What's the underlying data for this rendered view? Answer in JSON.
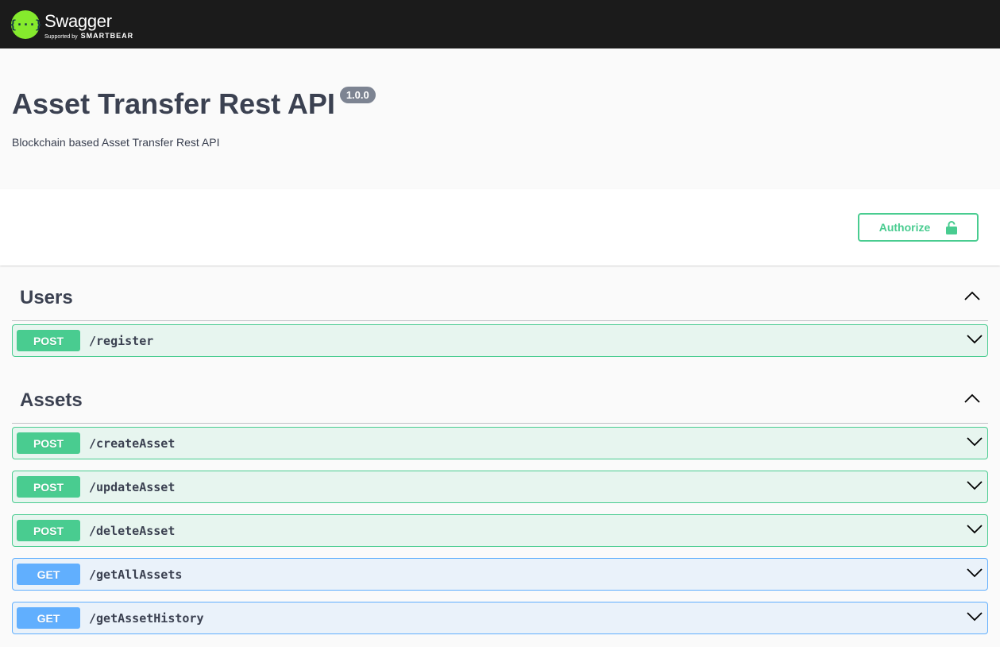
{
  "topbar": {
    "logo_glyph": "{···}",
    "logo_name": "Swagger",
    "logo_sub": "Supported by",
    "logo_brand": "SMARTBEAR"
  },
  "info": {
    "title": "Asset Transfer Rest API",
    "version": "1.0.0",
    "description": "Blockchain based Asset Transfer Rest API"
  },
  "auth": {
    "label": "Authorize",
    "icon": "lock-icon"
  },
  "tags": [
    {
      "name": "Users",
      "operations": [
        {
          "method": "POST",
          "path": "/register"
        }
      ]
    },
    {
      "name": "Assets",
      "operations": [
        {
          "method": "POST",
          "path": "/createAsset"
        },
        {
          "method": "POST",
          "path": "/updateAsset"
        },
        {
          "method": "POST",
          "path": "/deleteAsset"
        },
        {
          "method": "GET",
          "path": "/getAllAssets"
        },
        {
          "method": "GET",
          "path": "/getAssetHistory"
        }
      ]
    }
  ],
  "colors": {
    "post": "#49cc90",
    "get": "#61affe",
    "topbar": "#1b1b1b",
    "logo": "#85ea2d"
  }
}
